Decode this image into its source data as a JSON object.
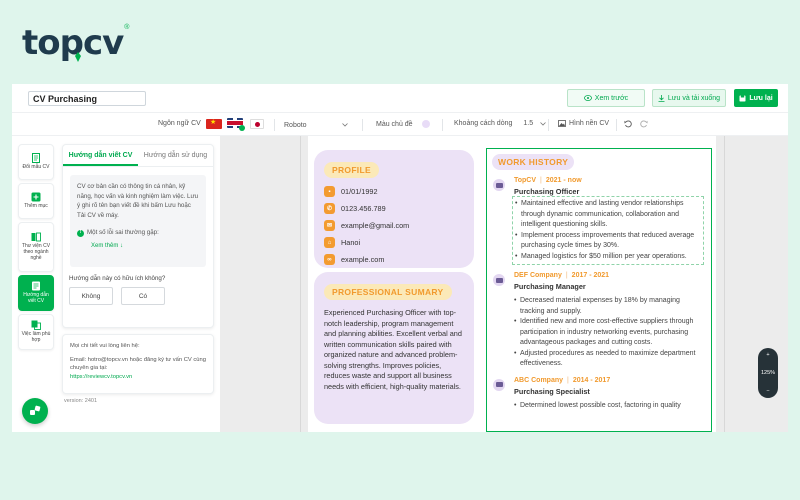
{
  "logo": {
    "text_a": "top",
    "text_b": "cv",
    "reg": "®"
  },
  "colors": {
    "brand_green": "#00b14f",
    "accent_orange": "#f19a2e",
    "card_lavender": "#ece2f6",
    "label_yellow": "#fbe9b8",
    "bg_mint": "#dff5ec"
  },
  "topbar": {
    "title_value": "CV Purchasing",
    "preview_label": "Xem trước",
    "save_download_label": "Lưu và tải xuống",
    "save_label": "Lưu lại"
  },
  "toolbar": {
    "language_label": "Ngôn ngữ CV",
    "font_value": "Roboto",
    "theme_color_label": "Màu chủ đề",
    "line_spacing_label": "Khoảng cách dòng",
    "line_spacing_value": "1.5",
    "background_label": "Hình nền CV"
  },
  "rail": {
    "items": [
      {
        "label": "Đổi mẫu CV",
        "icon": "swap-template-icon"
      },
      {
        "label": "Thêm mục",
        "icon": "add-section-icon"
      },
      {
        "label": "Thư viện CV theo ngành nghề",
        "icon": "library-icon"
      },
      {
        "label": "Hướng dẫn viết CV",
        "icon": "guide-icon"
      },
      {
        "label": "Việc làm phù hợp",
        "icon": "jobs-icon"
      }
    ]
  },
  "guide": {
    "tab_write": "Hướng dẫn viết CV",
    "tab_use": "Hướng dẫn sử dụng",
    "body": "CV cơ bản cần có thông tin cá nhân, kỹ năng, học vấn và kinh nghiệm làm việc. Lưu ý ghi rõ tên bạn viết đề khi bấm Lưu hoặc Tải CV về máy.",
    "tip": "Một số lỗi sai thường gặp:",
    "more": "Xem thêm ↓",
    "question": "Hướng dẫn này có hữu ích không?",
    "no": "Không",
    "yes": "Có"
  },
  "contact_box": {
    "line1": "Mọi chi tiết vui lòng liên hệ:",
    "line2": "Email: hotro@topcv.vn hoặc đăng ký tư vấn CV cùng chuyên gia tại:",
    "link": "https://reviewcv.topcv.vn"
  },
  "version": "version: 2401",
  "cv": {
    "profile_label": "PROFILE",
    "dob": "01/01/1992",
    "phone": "0123.456.789",
    "email": "example@gmail.com",
    "city": "Hanoi",
    "website": "example.com",
    "summary_label": "PROFESSIONAL SUMARY",
    "summary": "Experienced Purchasing Officer with top-notch leadership, program management and planning abilities. Excellent verbal and written communication skills paired with organized nature and advanced problem-solving strengths. Improves policies, reduces waste and support all business needs with efficient, high-quality materials.",
    "work_label": "WORK HISTORY",
    "jobs": [
      {
        "company": "TopCV",
        "period": "2021 - now",
        "role": "Purchasing Officer",
        "bullets": [
          "Maintained effective and lasting vendor relationships through dynamic communication, collaboration and intelligent questioning skills.",
          "Implement process improvements that reduced average purchasing cycle times by 30%.",
          "Managed logistics for $50 million per year operations."
        ]
      },
      {
        "company": "DEF Company",
        "period": "2017 - 2021",
        "role": "Purchasing Manager",
        "bullets": [
          "Decreased material expenses by 18% by managing tracking and supply.",
          "Identified new and more cost-effective suppliers through participation in industry networking events, purchasing advantageous packages and cutting costs.",
          "Adjusted procedures as needed to maximize department effectiveness."
        ]
      },
      {
        "company": "ABC Company",
        "period": "2014 - 2017",
        "role": "Purchasing Specialist",
        "bullets": [
          "Determined lowest possible cost, factoring in quality"
        ]
      }
    ]
  },
  "zoom": {
    "plus": "+",
    "value": "125%",
    "minus": "−"
  }
}
